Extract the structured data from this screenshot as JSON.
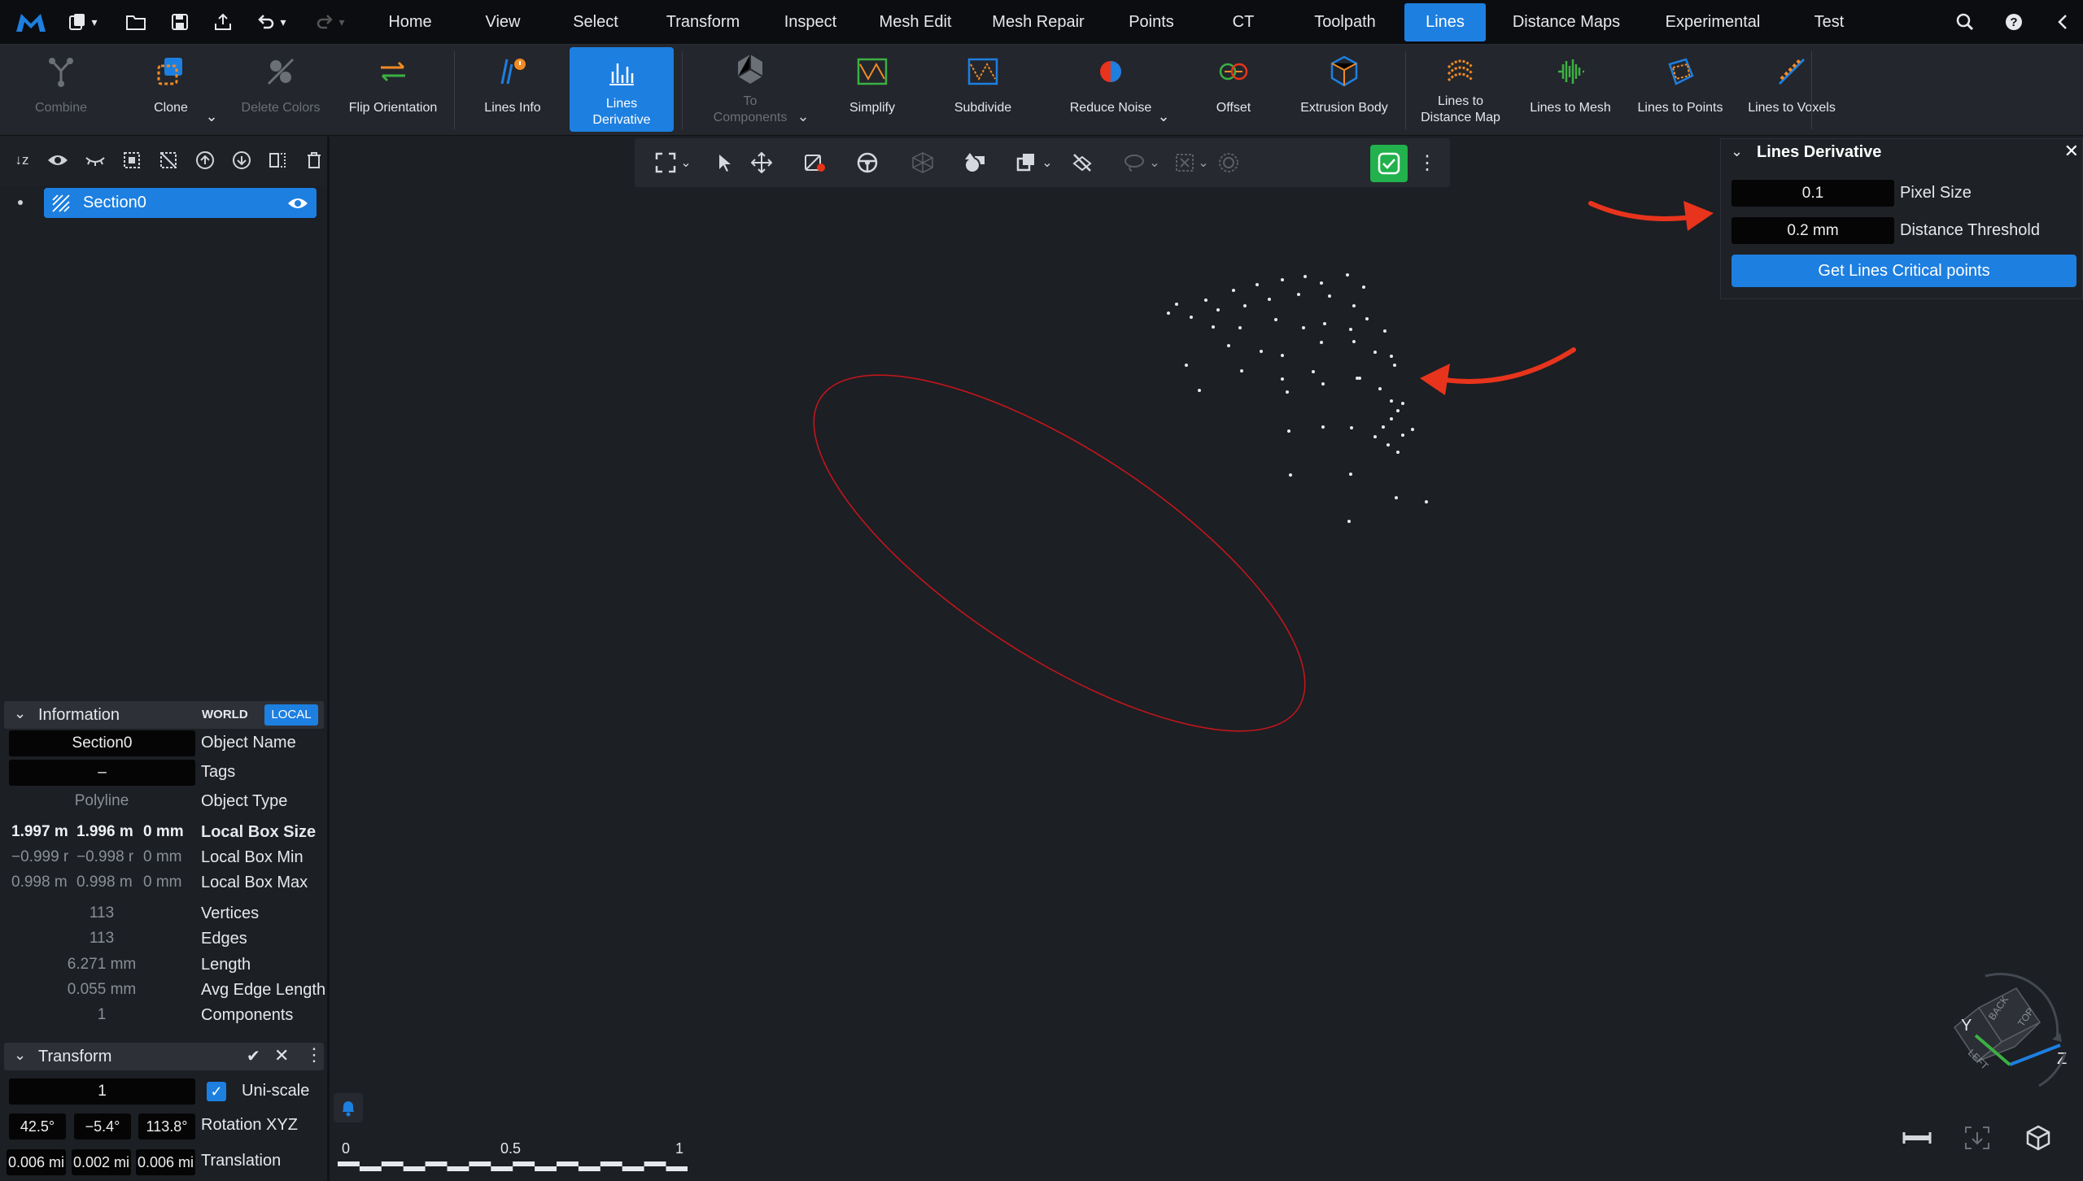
{
  "menu": {
    "home": "Home",
    "view": "View",
    "select": "Select",
    "transform": "Transform",
    "inspect": "Inspect",
    "mesh_edit": "Mesh Edit",
    "mesh_repair": "Mesh Repair",
    "points": "Points",
    "ct": "CT",
    "toolpath": "Toolpath",
    "lines": "Lines",
    "distance_maps": "Distance Maps",
    "experimental": "Experimental",
    "test": "Test"
  },
  "ribbon": {
    "combine": "Combine",
    "clone": "Clone",
    "delete_colors": "Delete Colors",
    "flip_orientation": "Flip Orientation",
    "lines_info": "Lines Info",
    "lines_derivative_1": "Lines",
    "lines_derivative_2": "Derivative",
    "to_components_1": "To",
    "to_components_2": "Components",
    "simplify": "Simplify",
    "subdivide": "Subdivide",
    "reduce_noise": "Reduce Noise",
    "offset": "Offset",
    "extrusion_body": "Extrusion Body",
    "lines_to_distance_map_1": "Lines to",
    "lines_to_distance_map_2": "Distance Map",
    "lines_to_mesh": "Lines to Mesh",
    "lines_to_points": "Lines to Points",
    "lines_to_voxels": "Lines to Voxels"
  },
  "tree": {
    "section": "Section0"
  },
  "info": {
    "title": "Information",
    "world": "WORLD",
    "local": "LOCAL",
    "object_name_value": "Section0",
    "object_name_key": "Object Name",
    "tags_value": "–",
    "tags_key": "Tags",
    "object_type_value": "Polyline",
    "object_type_key": "Object Type",
    "box_size": [
      "1.997 m",
      "1.996 m",
      "0 mm"
    ],
    "box_size_key": "Local Box Size",
    "box_min": [
      "−0.999 r",
      "−0.998 r",
      "0 mm"
    ],
    "box_min_key": "Local Box Min",
    "box_max": [
      "0.998 m",
      "0.998 m",
      "0 mm"
    ],
    "box_max_key": "Local Box Max",
    "vertices_value": "113",
    "vertices_key": "Vertices",
    "edges_value": "113",
    "edges_key": "Edges",
    "length_value": "6.271 mm",
    "length_key": "Length",
    "avg_edge_value": "0.055 mm",
    "avg_edge_key": "Avg Edge Length",
    "components_value": "1",
    "components_key": "Components"
  },
  "transform": {
    "title": "Transform",
    "scale_value": "1",
    "uniscale_label": "Uni-scale",
    "rotation": [
      "42.5°",
      "−5.4°",
      "113.8°"
    ],
    "rotation_key": "Rotation XYZ",
    "translation": [
      "0.006 mi",
      "0.002 mi",
      "0.006 mi"
    ],
    "translation_key": "Translation"
  },
  "lines_derivative": {
    "title": "Lines Derivative",
    "pixel_size_value": "0.1",
    "pixel_size_key": "Pixel Size",
    "distance_value": "0.2 mm",
    "distance_key": "Distance Threshold",
    "button": "Get Lines Critical points"
  },
  "scale_bar": {
    "t0": "0",
    "t1": "0.5",
    "t2": "1"
  },
  "axes": {
    "y": "Y",
    "z": "Z",
    "cube_back": "BACK",
    "cube_top": "TOP",
    "cube_left": "LEFT"
  },
  "colors": {
    "accent": "#1d7fe0",
    "annotation_red": "#e8341c",
    "ellipse_red": "#c0161c",
    "check_green": "#22b14c"
  }
}
